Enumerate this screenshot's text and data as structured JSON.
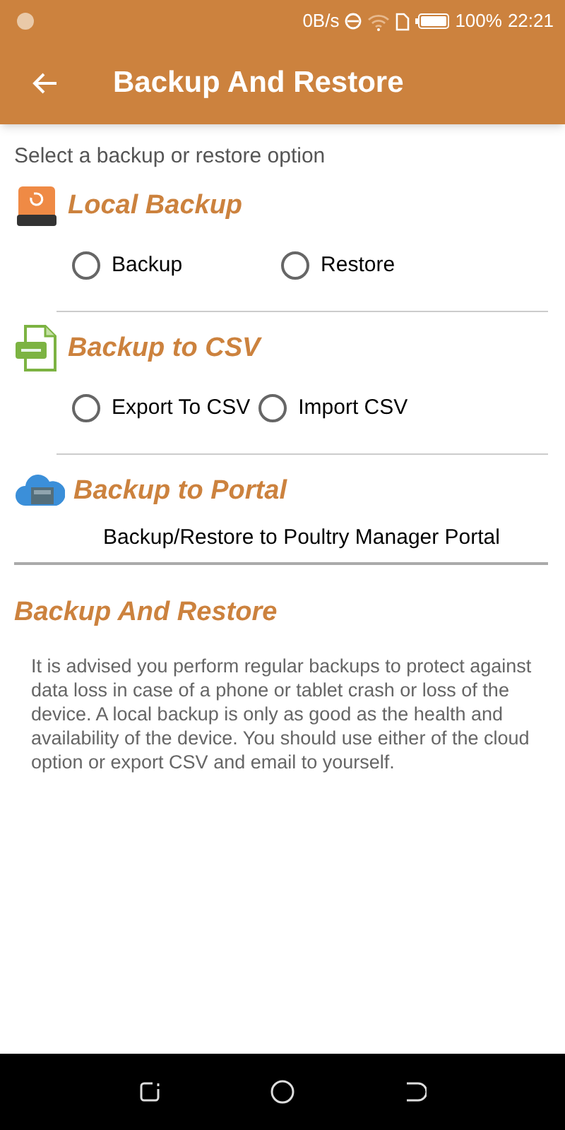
{
  "status_bar": {
    "speed": "0B/s",
    "battery": "100%",
    "time": "22:21"
  },
  "app_bar": {
    "title": "Backup And Restore"
  },
  "prompt": "Select a backup or restore option",
  "sections": [
    {
      "kind": "drive",
      "title": "Local Backup",
      "options": [
        {
          "label": "Backup",
          "selected": false
        },
        {
          "label": "Restore",
          "selected": false
        }
      ]
    },
    {
      "kind": "csv",
      "title": "Backup to CSV",
      "options": [
        {
          "label": "Export To CSV",
          "selected": false
        },
        {
          "label": "Import CSV",
          "selected": false
        }
      ]
    },
    {
      "kind": "cloud",
      "title": "Backup to Portal",
      "link": "Backup/Restore to Poultry Manager Portal"
    }
  ],
  "info": {
    "title": "Backup And Restore",
    "text": "It is advised you perform regular backups to protect against data loss in case of a phone or tablet crash or loss of the device. A local backup is only as good as the health and availability of the device. You should use either of the cloud option or export CSV and email to yourself."
  }
}
